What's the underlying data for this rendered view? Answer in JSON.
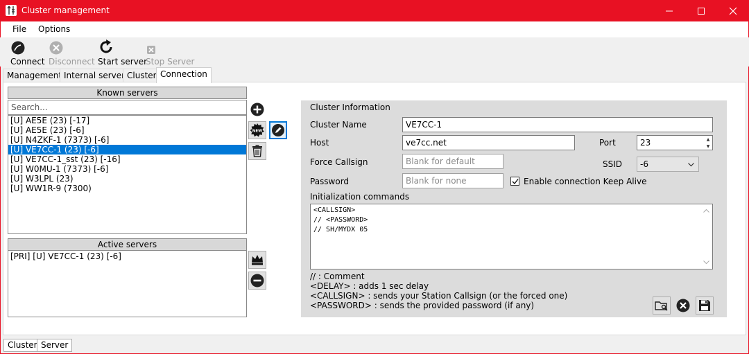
{
  "window": {
    "title": "Cluster management",
    "accent_color": "#e81123",
    "controls": {
      "minimize": "minimize-icon",
      "maximize": "maximize-icon",
      "close": "close-icon"
    }
  },
  "menu": {
    "file": "File",
    "options": "Options"
  },
  "toolbar": {
    "connect": "Connect",
    "disconnect": "Disconnect",
    "start_server": "Start server",
    "stop_server": "Stop Server"
  },
  "tabs": {
    "management": "Management",
    "internal_server": "Internal server",
    "cluster": "Cluster",
    "connection": "Connection",
    "active": "Connection"
  },
  "known_servers": {
    "header": "Known servers",
    "search_placeholder": "Search...",
    "items": [
      "[U] AE5E (23) [-17]",
      "[U] AE5E (23) [-6]",
      "[U] N4ZKF-1 (7373) [-6]",
      "[U] VE7CC-1 (23) [-6]",
      "[U] VE7CC-1_sst (23) [-16]",
      "[U] W0MU-1 (7373) [-6]",
      "[U] W3LPL (23)",
      "[U] WW1R-9 (7300)"
    ],
    "selected_index": 3
  },
  "active_servers": {
    "header": "Active servers",
    "items": [
      "[PRI] [U] VE7CC-1 (23) [-6]"
    ]
  },
  "side_buttons": {
    "add": "add-circle-icon",
    "new": "new-badge-icon",
    "new_badge_text": "NEW",
    "edit": "edit-pencil-icon",
    "delete": "trash-icon",
    "primary": "crown-icon",
    "remove": "minus-circle-icon"
  },
  "cluster_info": {
    "heading": "Cluster Information",
    "cluster_name_label": "Cluster Name",
    "cluster_name": "VE7CC-1",
    "host_label": "Host",
    "host": "ve7cc.net",
    "port_label": "Port",
    "port": "23",
    "force_callsign_label": "Force Callsign",
    "force_callsign_placeholder": "Blank for default",
    "ssid_label": "SSID",
    "ssid": "-6",
    "password_label": "Password",
    "password_placeholder": "Blank for none",
    "keepalive_label": "Enable connection Keep Alive",
    "keepalive_checked": true,
    "init_label": "Initialization commands",
    "init_lines": [
      "<CALLSIGN>",
      "// <PASSWORD>",
      "// SH/MYDX 05"
    ],
    "help": [
      "// : Comment",
      "<DELAY> : adds 1 sec delay",
      "<CALLSIGN> : sends your Station Callsign (or the forced one)",
      "<PASSWORD> : sends the provided password (if any)"
    ]
  },
  "status_tabs": {
    "cluster": "Cluster",
    "server": "Server"
  }
}
